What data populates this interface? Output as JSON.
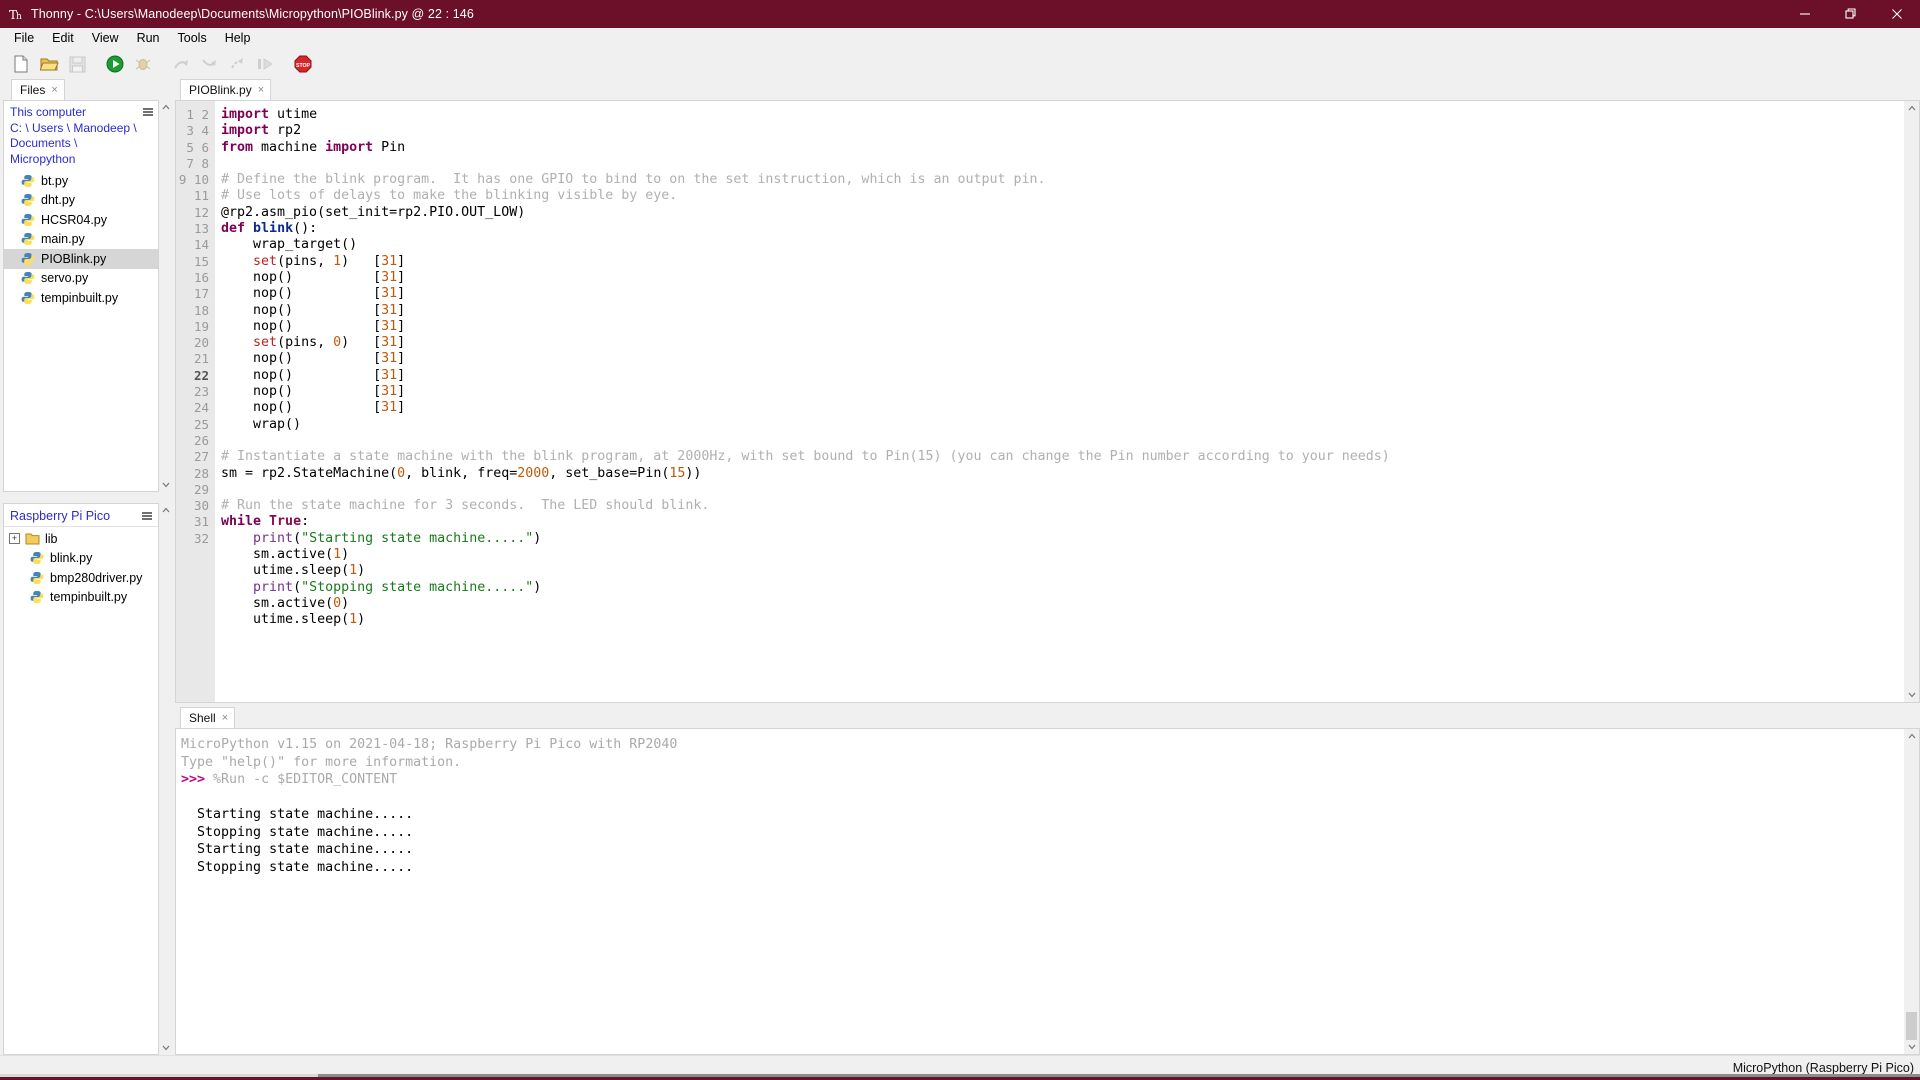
{
  "window": {
    "app_name": "Thonny",
    "title": "Thonny  -  C:\\Users\\Manodeep\\Documents\\Micropython\\PIOBlink.py  @  22 : 146",
    "minimize_label": "Minimize",
    "maximize_label": "Maximize",
    "close_label": "Close",
    "title_bar_color": "#6b1028"
  },
  "menubar": {
    "items": [
      {
        "label": "File"
      },
      {
        "label": "Edit"
      },
      {
        "label": "View"
      },
      {
        "label": "Run"
      },
      {
        "label": "Tools"
      },
      {
        "label": "Help"
      }
    ]
  },
  "toolbar": {
    "buttons": [
      {
        "name": "new-file-icon",
        "label": "New",
        "enabled": true
      },
      {
        "name": "open-file-icon",
        "label": "Open",
        "enabled": true
      },
      {
        "name": "save-file-icon",
        "label": "Save",
        "enabled": false
      },
      {
        "name": "run-icon",
        "label": "Run current script",
        "enabled": true
      },
      {
        "name": "debug-icon",
        "label": "Debug current script",
        "enabled": false
      },
      {
        "name": "step-over-icon",
        "label": "Step over",
        "enabled": false
      },
      {
        "name": "step-into-icon",
        "label": "Step into",
        "enabled": false
      },
      {
        "name": "step-out-icon",
        "label": "Step out",
        "enabled": false
      },
      {
        "name": "resume-icon",
        "label": "Resume",
        "enabled": false
      },
      {
        "name": "stop-icon",
        "label": "Stop/Restart backend",
        "enabled": true
      }
    ]
  },
  "files_panel": {
    "tab_label": "Files",
    "tab_close": "×",
    "menu_icon": "hamburger-icon",
    "root_label": "This computer",
    "path_line1": "C: \\ Users \\ Manodeep \\",
    "path_line2": "Documents \\ Micropython",
    "items": [
      {
        "name": "bt.py",
        "selected": false
      },
      {
        "name": "dht.py",
        "selected": false
      },
      {
        "name": "HCSR04.py",
        "selected": false
      },
      {
        "name": "main.py",
        "selected": false
      },
      {
        "name": "PIOBlink.py",
        "selected": true
      },
      {
        "name": "servo.py",
        "selected": false
      },
      {
        "name": "tempinbuilt.py",
        "selected": false
      }
    ]
  },
  "device_panel": {
    "title": "Raspberry Pi Pico",
    "menu_icon": "hamburger-icon",
    "items": [
      {
        "name": "lib",
        "type": "folder",
        "expander": "+"
      },
      {
        "name": "blink.py",
        "type": "file"
      },
      {
        "name": "bmp280driver.py",
        "type": "file"
      },
      {
        "name": "tempinbuilt.py",
        "type": "file"
      }
    ]
  },
  "editor": {
    "tab_label": "PIOBlink.py",
    "tab_close": "×",
    "current_line": 22,
    "total_lines": 32,
    "lines": [
      "import utime",
      "import rp2",
      "from machine import Pin",
      "",
      "# Define the blink program.  It has one GPIO to bind to on the set instruction, which is an output pin.",
      "# Use lots of delays to make the blinking visible by eye.",
      "@rp2.asm_pio(set_init=rp2.PIO.OUT_LOW)",
      "def blink():",
      "    wrap_target()",
      "    set(pins, 1)   [31]",
      "    nop()          [31]",
      "    nop()          [31]",
      "    nop()          [31]",
      "    nop()          [31]",
      "    set(pins, 0)   [31]",
      "    nop()          [31]",
      "    nop()          [31]",
      "    nop()          [31]",
      "    nop()          [31]",
      "    wrap()",
      "",
      "# Instantiate a state machine with the blink program, at 2000Hz, with set bound to Pin(15) (you can change the Pin number according to your needs)",
      "sm = rp2.StateMachine(0, blink, freq=2000, set_base=Pin(15))",
      "",
      "# Run the state machine for 3 seconds.  The LED should blink.",
      "while True:",
      "    print(\"Starting state machine.....\")",
      "    sm.active(1)",
      "    utime.sleep(1)",
      "    print(\"Stopping state machine.....\")",
      "    sm.active(0)",
      "    utime.sleep(1)"
    ]
  },
  "shell": {
    "tab_label": "Shell",
    "tab_close": "×",
    "banner_line1": "MicroPython v1.15 on 2021-04-18; Raspberry Pi Pico with RP2040",
    "banner_line2": "Type \"help()\" for more information.",
    "prompt": ">>>",
    "command": "%Run -c $EDITOR_CONTENT",
    "output": [
      "Starting state machine.....",
      "Stopping state machine.....",
      "Starting state machine.....",
      "Stopping state machine....."
    ]
  },
  "statusbar": {
    "interpreter": "MicroPython (Raspberry Pi Pico)"
  }
}
